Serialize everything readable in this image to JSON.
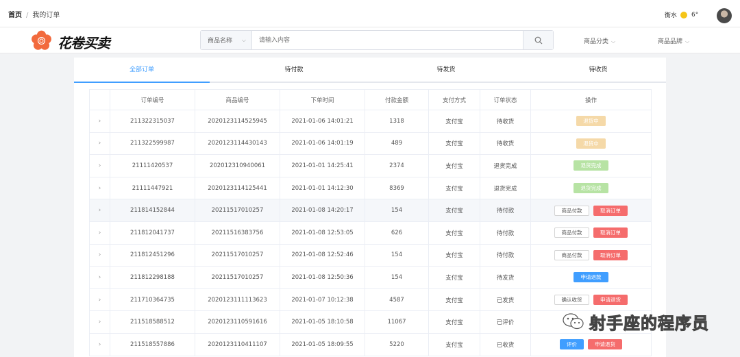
{
  "breadcrumb": {
    "home": "首页",
    "separator": "/",
    "current": "我的订单"
  },
  "weather": {
    "city": "衡水",
    "temp": "6°",
    "icon": "sun-icon"
  },
  "brand": {
    "name": "花卷买卖",
    "color": "#f26a3d"
  },
  "search": {
    "category": "商品名称",
    "placeholder": "请输入内容"
  },
  "nav": {
    "category": "商品分类",
    "brand": "商品品牌"
  },
  "tabs": [
    {
      "label": "全部订单",
      "active": true
    },
    {
      "label": "待付款"
    },
    {
      "label": "待发货"
    },
    {
      "label": "待收货"
    }
  ],
  "table": {
    "columns": [
      "",
      "订单编号",
      "商品编号",
      "下单时间",
      "付款金额",
      "支付方式",
      "订单状态",
      "操作"
    ],
    "rows": [
      {
        "order_id": "211322315037",
        "product_id": "2020123114525945",
        "time": "2021-01-06 14:01:21",
        "amount": "1318",
        "pay": "支付宝",
        "status": "待收货",
        "actions": [
          {
            "label": "退货中",
            "style": "orange"
          }
        ]
      },
      {
        "order_id": "211322599987",
        "product_id": "2020123114430143",
        "time": "2021-01-06 14:01:19",
        "amount": "489",
        "pay": "支付宝",
        "status": "待收货",
        "actions": [
          {
            "label": "退货中",
            "style": "orange"
          }
        ]
      },
      {
        "order_id": "21111420537",
        "product_id": "202012310940061",
        "time": "2021-01-01 14:25:41",
        "amount": "2374",
        "pay": "支付宝",
        "status": "退货完成",
        "actions": [
          {
            "label": "退货完成",
            "style": "green"
          }
        ]
      },
      {
        "order_id": "21111447921",
        "product_id": "2020123114125441",
        "time": "2021-01-01 14:12:30",
        "amount": "8369",
        "pay": "支付宝",
        "status": "退货完成",
        "actions": [
          {
            "label": "退货完成",
            "style": "green"
          }
        ]
      },
      {
        "order_id": "211814152844",
        "product_id": "20211517010257",
        "time": "2021-01-08 14:20:17",
        "amount": "154",
        "pay": "支付宝",
        "status": "待付款",
        "highlight": true,
        "actions": [
          {
            "label": "商品付款",
            "style": "white"
          },
          {
            "label": "取消订单",
            "style": "red"
          }
        ]
      },
      {
        "order_id": "211812041737",
        "product_id": "20211516383756",
        "time": "2021-01-08 12:53:05",
        "amount": "626",
        "pay": "支付宝",
        "status": "待付款",
        "actions": [
          {
            "label": "商品付款",
            "style": "white"
          },
          {
            "label": "取消订单",
            "style": "red"
          }
        ]
      },
      {
        "order_id": "211812451296",
        "product_id": "20211517010257",
        "time": "2021-01-08 12:52:46",
        "amount": "154",
        "pay": "支付宝",
        "status": "待付款",
        "actions": [
          {
            "label": "商品付款",
            "style": "white"
          },
          {
            "label": "取消订单",
            "style": "red"
          }
        ]
      },
      {
        "order_id": "211812298188",
        "product_id": "20211517010257",
        "time": "2021-01-08 12:50:36",
        "amount": "154",
        "pay": "支付宝",
        "status": "待发货",
        "actions": [
          {
            "label": "申请退款",
            "style": "blue"
          }
        ]
      },
      {
        "order_id": "211710364735",
        "product_id": "2020123111113623",
        "time": "2021-01-07 10:12:38",
        "amount": "4587",
        "pay": "支付宝",
        "status": "已发货",
        "actions": [
          {
            "label": "确认收货",
            "style": "white"
          },
          {
            "label": "申请退货",
            "style": "red"
          }
        ]
      },
      {
        "order_id": "211518588512",
        "product_id": "2020123110591616",
        "time": "2021-01-05 18:10:58",
        "amount": "11067",
        "pay": "支付宝",
        "status": "已评价",
        "actions": []
      },
      {
        "order_id": "211518557886",
        "product_id": "2020123110411107",
        "time": "2021-01-05 18:09:55",
        "amount": "5220",
        "pay": "支付宝",
        "status": "已收货",
        "actions": [
          {
            "label": "评价",
            "style": "blue-s"
          },
          {
            "label": "申请退货",
            "style": "red"
          }
        ]
      }
    ]
  },
  "watermark": {
    "text": "射手座的程序员",
    "icon": "wechat-icon"
  }
}
